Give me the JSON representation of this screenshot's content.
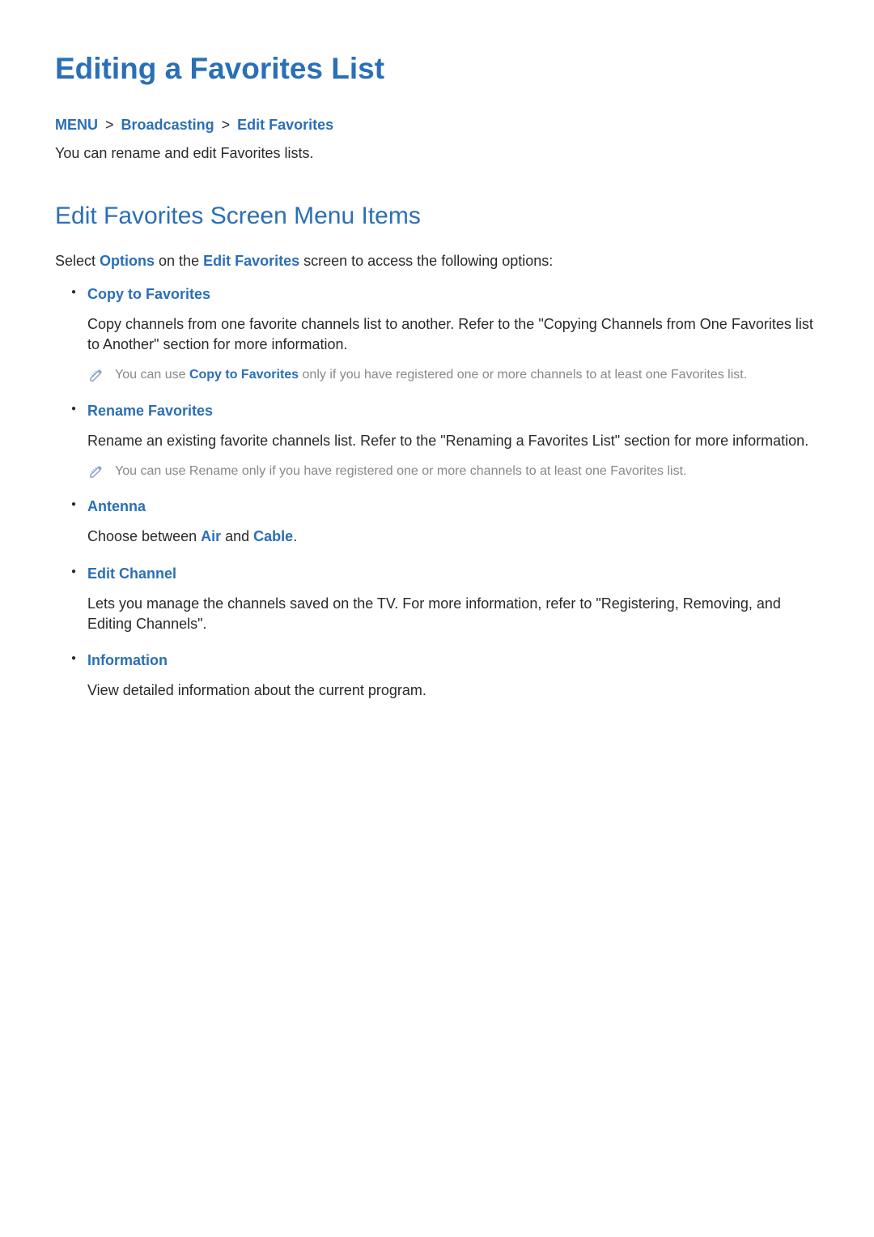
{
  "page_title": "Editing a Favorites List",
  "breadcrumb": {
    "menu": "MENU",
    "broadcasting": "Broadcasting",
    "edit_favorites": "Edit Favorites",
    "sep": ">"
  },
  "intro": "You can rename and edit Favorites lists.",
  "section": {
    "title": "Edit Favorites Screen Menu Items",
    "intro_prefix": "Select ",
    "intro_options": "Options",
    "intro_mid": " on the ",
    "intro_editfav": "Edit Favorites",
    "intro_suffix": " screen to access the following options:"
  },
  "items": [
    {
      "title": "Copy to Favorites",
      "body": "Copy channels from one favorite channels list to another. Refer to the \"Copying Channels from One Favorites list to Another\" section for more information.",
      "note_prefix": "You can use ",
      "note_link": "Copy to Favorites",
      "note_suffix": " only if you have registered one or more channels to at least one Favorites list."
    },
    {
      "title": "Rename Favorites",
      "body": "Rename an existing favorite channels list. Refer to the \"Renaming a Favorites List\" section for more information.",
      "note_full": "You can use Rename only if you have registered one or more channels to at least one Favorites list."
    },
    {
      "title": "Antenna",
      "body_prefix": "Choose between ",
      "body_link1": "Air",
      "body_mid": " and ",
      "body_link2": "Cable",
      "body_suffix": "."
    },
    {
      "title": "Edit Channel",
      "body": "Lets you manage the channels saved on the TV. For more information, refer to \"Registering, Removing, and Editing Channels\"."
    },
    {
      "title": "Information",
      "body": "View detailed information about the current program."
    }
  ]
}
